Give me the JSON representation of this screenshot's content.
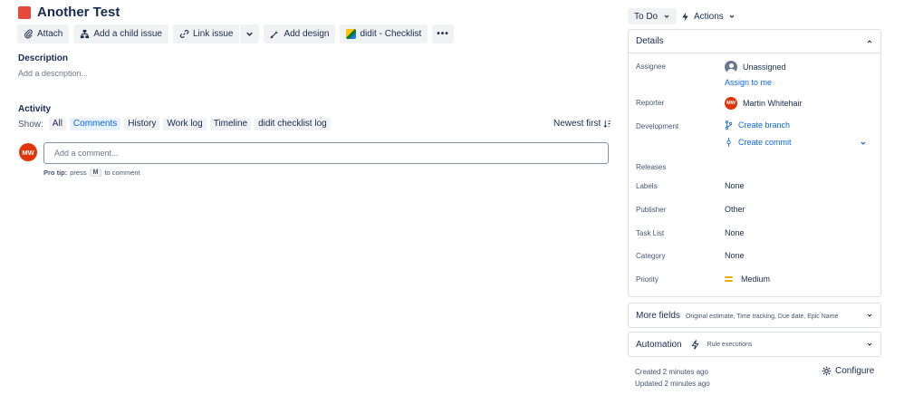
{
  "issue": {
    "title": "Another Test",
    "type_color": "#e5493a"
  },
  "toolbar": {
    "attach": "Attach",
    "add_child": "Add a child issue",
    "link_issue": "Link issue",
    "add_design": "Add design",
    "didit_checklist": "didit - Checklist",
    "more": "•••"
  },
  "description": {
    "label": "Description",
    "placeholder": "Add a description..."
  },
  "activity": {
    "label": "Activity",
    "show_label": "Show:",
    "filters": [
      "All",
      "Comments",
      "History",
      "Work log",
      "Timeline",
      "didit checklist log"
    ],
    "active_filter": "Comments",
    "sort": "Newest first"
  },
  "comment": {
    "avatar_initials": "MW",
    "placeholder": "Add a comment...",
    "protip_prefix": "Pro tip:",
    "protip_press": "press",
    "protip_key": "M",
    "protip_suffix": "to comment"
  },
  "status": {
    "label": "To Do"
  },
  "actions": {
    "label": "Actions"
  },
  "details": {
    "title": "Details",
    "assignee_label": "Assignee",
    "assignee_value": "Unassigned",
    "assign_to_me": "Assign to me",
    "reporter_label": "Reporter",
    "reporter_initials": "MW",
    "reporter_value": "Martin Whitehair",
    "development_label": "Development",
    "create_branch": "Create branch",
    "create_commit": "Create commit",
    "releases_label": "Releases",
    "labels_label": "Labels",
    "labels_value": "None",
    "publisher_label": "Publisher",
    "publisher_value": "Other",
    "tasklist_label": "Task List",
    "tasklist_value": "None",
    "category_label": "Category",
    "category_value": "None",
    "priority_label": "Priority",
    "priority_value": "Medium"
  },
  "more_fields": {
    "title": "More fields",
    "subtitle": "Original estimate, Time tracking, Due date, Epic Name"
  },
  "automation": {
    "title": "Automation",
    "subtitle": "Rule executions"
  },
  "meta": {
    "created": "Created 2 minutes ago",
    "updated": "Updated 2 minutes ago",
    "configure": "Configure"
  },
  "colors": {
    "accent": "#0c66e4",
    "avatar": "#de350b",
    "priority": "#e2b203"
  }
}
